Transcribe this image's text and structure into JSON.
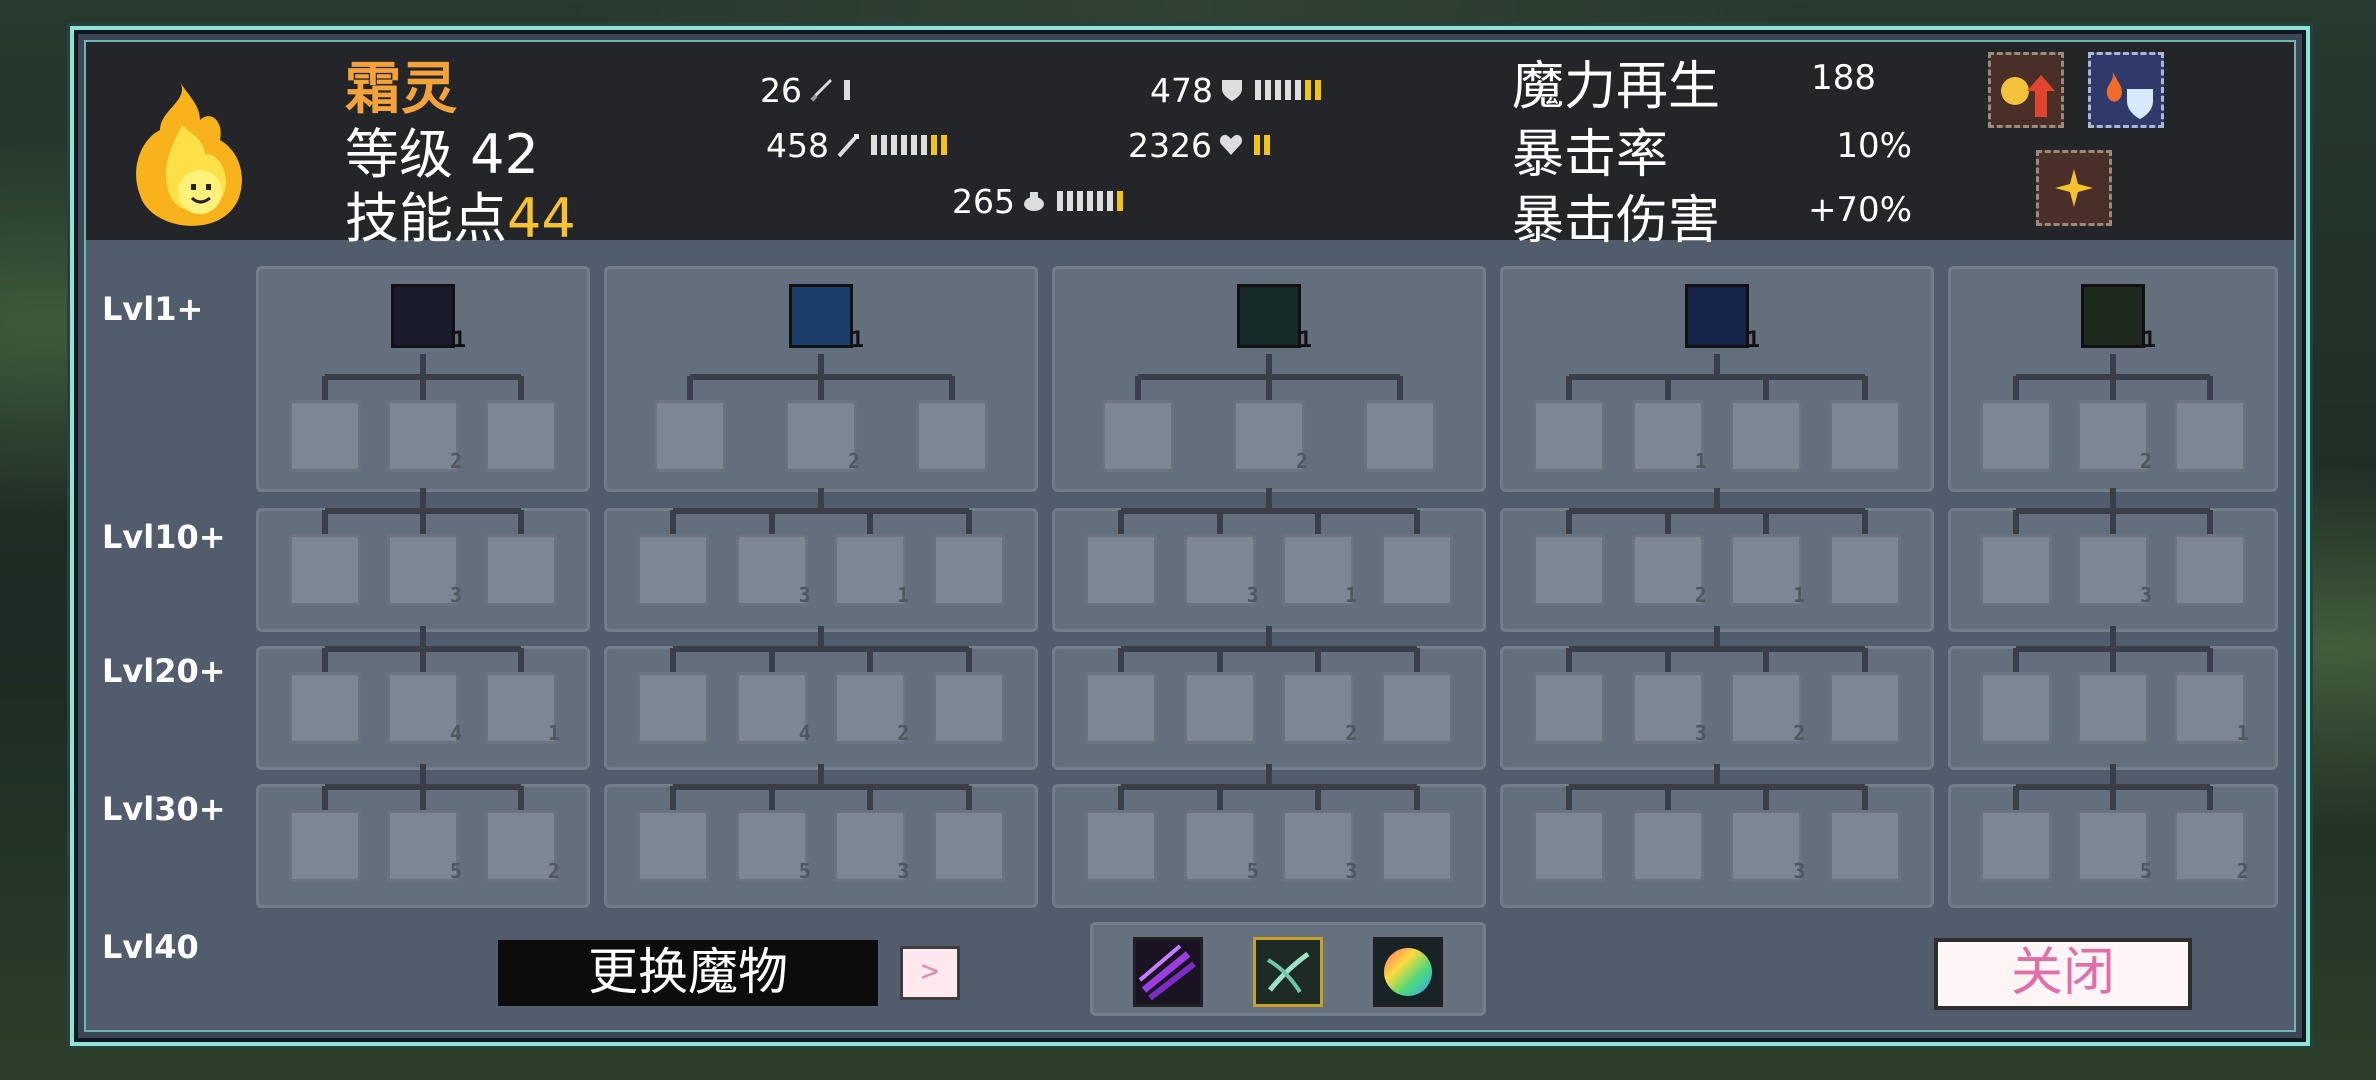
{
  "monster": {
    "name": "霜灵",
    "level_label": "等级",
    "level": "42",
    "skill_points_label": "技能点",
    "skill_points": "44"
  },
  "stats": {
    "attack": {
      "value": "26",
      "icon": "sword-icon",
      "pips_white": 1,
      "pips_yellow": 0
    },
    "magic": {
      "value": "458",
      "icon": "wand-icon",
      "pips_white": 6,
      "pips_yellow": 2
    },
    "speed": {
      "value": "265",
      "icon": "boot-icon",
      "pips_white": 6,
      "pips_yellow": 1
    },
    "defense": {
      "value": "478",
      "icon": "shield-icon",
      "pips_white": 5,
      "pips_yellow": 2
    },
    "health": {
      "value": "2326",
      "icon": "heart-icon",
      "pips_white": 0,
      "pips_yellow": 2
    }
  },
  "right_stats": [
    {
      "label": "魔力再生",
      "value": "188"
    },
    {
      "label": "暴击率",
      "value": "10%"
    },
    {
      "label": "暴击伤害",
      "value": "+70%"
    }
  ],
  "levels": [
    "Lvl1+",
    "Lvl10+",
    "Lvl20+",
    "Lvl30+",
    "Lvl40"
  ],
  "trees": [
    {
      "root_icon": "blue-flame-icon",
      "root_color": "#1b1b2e",
      "root_count": "1",
      "rows": [
        [
          "",
          "2",
          ""
        ],
        [
          "",
          "3",
          ""
        ],
        [
          "",
          "4",
          "1"
        ],
        [
          "",
          "5",
          "2"
        ]
      ]
    },
    {
      "root_icon": "ice-orb-icon",
      "root_color": "#1b3d6a",
      "root_count": "1",
      "rows": [
        [
          "",
          "2",
          ""
        ],
        [
          "",
          "3",
          "1",
          ""
        ],
        [
          "",
          "4",
          "2",
          ""
        ],
        [
          "",
          "5",
          "3",
          ""
        ]
      ]
    },
    {
      "root_icon": "claw-slash-icon",
      "root_color": "#162a2a",
      "root_count": "1",
      "rows": [
        [
          "",
          "2",
          ""
        ],
        [
          "",
          "3",
          "1",
          ""
        ],
        [
          "",
          "",
          "2",
          ""
        ],
        [
          "",
          "5",
          "3",
          ""
        ]
      ]
    },
    {
      "root_icon": "blue-shield-icon",
      "root_color": "#16244a",
      "root_count": "1",
      "rows": [
        [
          "",
          "1",
          "",
          ""
        ],
        [
          "",
          "2",
          "1",
          ""
        ],
        [
          "",
          "3",
          "2",
          ""
        ],
        [
          "",
          "",
          "3",
          ""
        ]
      ]
    },
    {
      "root_icon": "green-shield-icon",
      "root_color": "#1f2a1f",
      "root_count": "1",
      "rows": [
        [
          "",
          "2",
          ""
        ],
        [
          "",
          "3",
          ""
        ],
        [
          "",
          "",
          "1"
        ],
        [
          "",
          "5",
          "2"
        ]
      ]
    }
  ],
  "bottom": {
    "prev_label": "<",
    "swap_label": "更换魔物",
    "next_label": ">",
    "close_label": "关闭"
  },
  "ability_slots": [
    "purple-slash-icon",
    "green-claw-icon",
    "rainbow-orb-icon"
  ],
  "colors": {
    "name": "#f3a33a",
    "accent_yellow": "#f7c230",
    "border_teal": "#8fe3d6",
    "close_text": "#df6fa6"
  }
}
